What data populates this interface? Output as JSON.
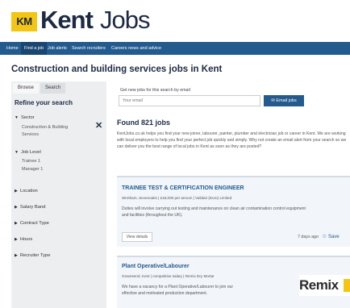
{
  "brand": {
    "km": "KM",
    "kent": "Kent",
    "jobs": "Jobs"
  },
  "nav": [
    "Home",
    "Find a job",
    "Job alerts",
    "Search recruiters",
    "Careers news and advice"
  ],
  "page_title": "Construction and building services jobs in Kent",
  "sidebar": {
    "tabs": [
      "Browse",
      "Search"
    ],
    "refine_title": "Refine your search",
    "sector_label": "Sector",
    "sector_value_line1": "Construction & Building",
    "sector_value_line2": "Services",
    "remove_glyph": "✕",
    "job_level_label": "Job Level",
    "job_level_items": [
      "Trainee 1",
      "Manager 1"
    ],
    "collapsed_filters": [
      "Location",
      "Salary Band",
      "Contract Type",
      "Hours",
      "Recruiter Type"
    ],
    "expanded_arrow": "▼",
    "collapsed_arrow": "▶"
  },
  "alert": {
    "label": "Get new jobs for this search by email",
    "placeholder": "Your email",
    "button": "✉ Email jobs"
  },
  "results": {
    "found": "Found 821 jobs",
    "intro": "KentJobs.co.uk helps you find your new joiner, labourer, painter, plumber and electrician job or career in Kent. We are working with local employers to help you find your perfect job quickly and simply. Why not create an email alert from your search so we can deliver you the best range of local jobs in Kent as soon as they are posted?"
  },
  "jobs": [
    {
      "title": "TRAINEE TEST & CERTIFICATION ENGINEER",
      "meta": "Wrotham, Sevenoaks  |  £18,000 per annum  |  Validair (Euro) Limited",
      "desc": "Duties will involve carrying out testing and maintenance on clean air contamination control equipment and facilities (throughout the UK).",
      "details": "View details",
      "posted": "7 days ago",
      "save": "Save",
      "star": "☆"
    },
    {
      "title": "Plant Operative/Labourer",
      "meta": "Gravesend, Kent  |  competitive salary  |  Remix Dry Mortar",
      "desc": "We have a vacancy for a Plant Operative/Labourer to join our effective and motivated production department.",
      "logo_text": "Remix"
    }
  ]
}
